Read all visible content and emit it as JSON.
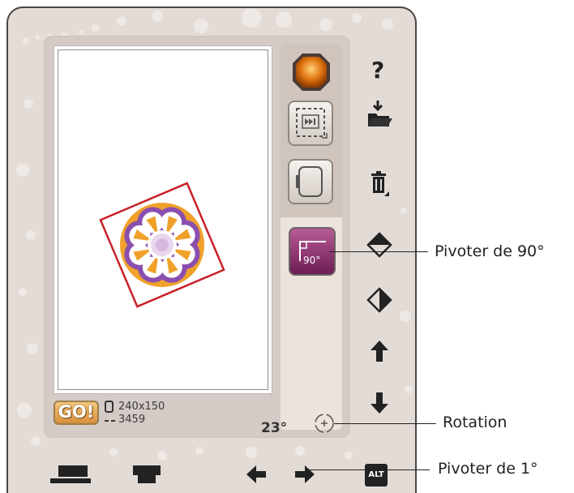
{
  "screen": {
    "go_label": "GO!",
    "hoop_size": "240x150",
    "stitch_count": "3459",
    "rotation_angle": "23°",
    "rotate_90_badge": "90°"
  },
  "callouts": {
    "rotate_90": "Pivoter de 90°",
    "rotation": "Rotation",
    "rotate_1": "Pivoter de 1°"
  },
  "toolbar": {
    "alt_label": "ALT",
    "help_label": "?"
  },
  "colors": {
    "frame_border": "#4a4646",
    "panel_bg": "#e3dbd6",
    "go_button": "#e6a84f",
    "rotate_button": "#9a3f7b",
    "design_box": "#c8222a",
    "design_purple": "#8a4fae",
    "design_orange": "#f0a12a"
  }
}
